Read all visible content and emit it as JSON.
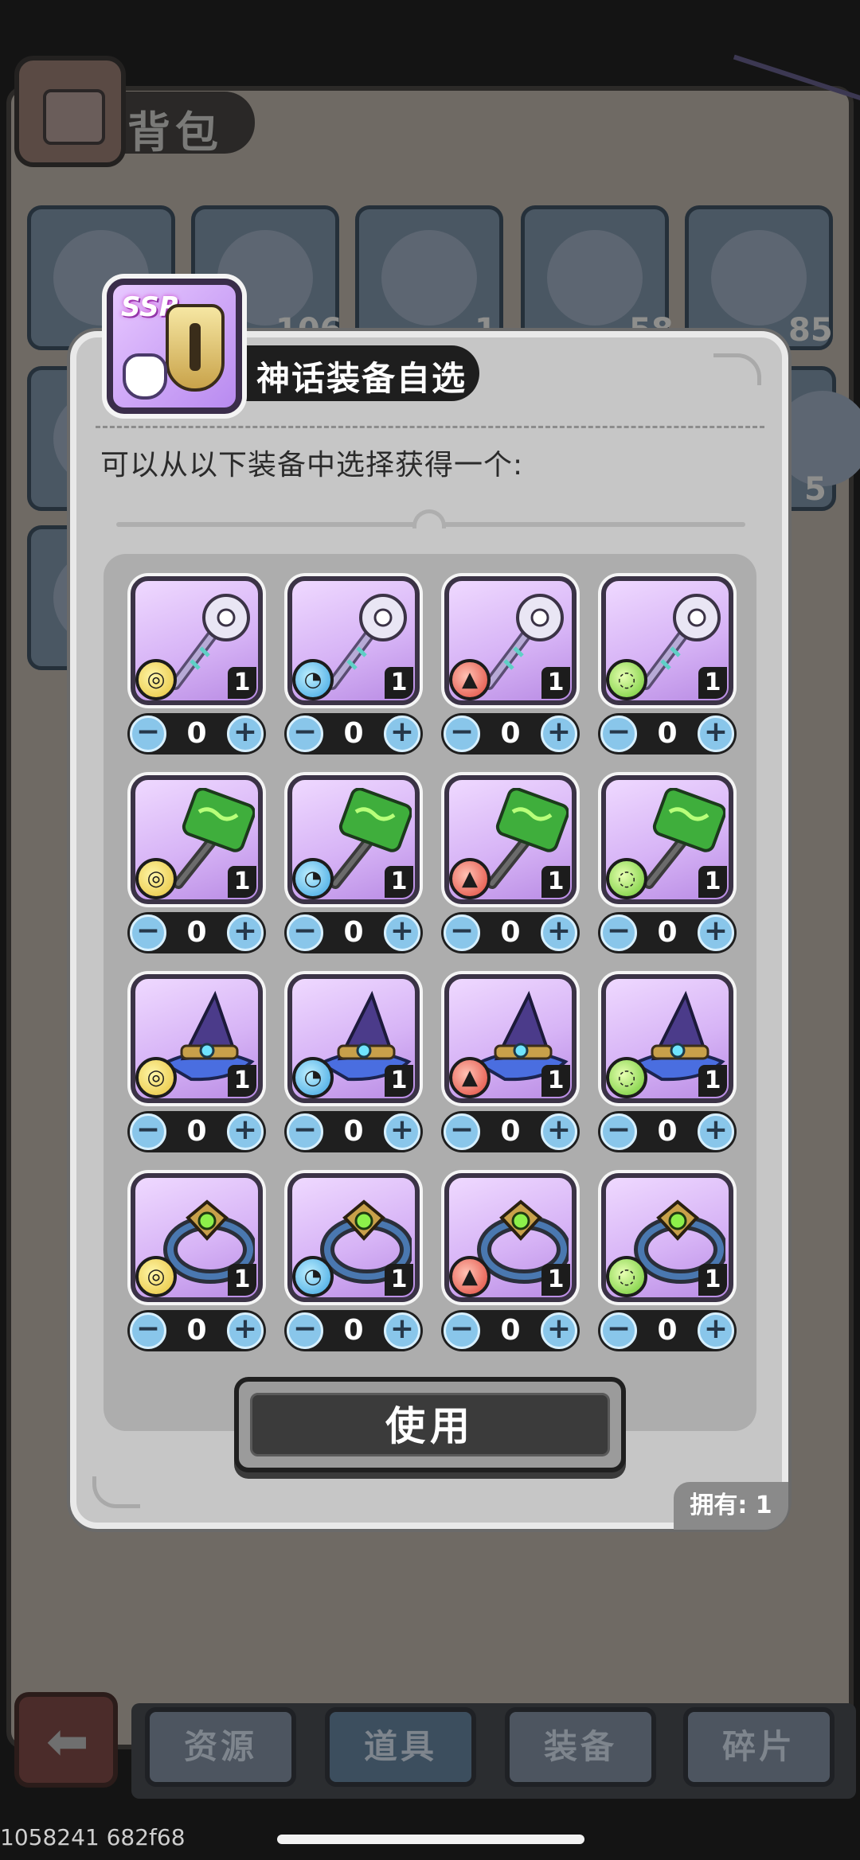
{
  "background": {
    "title": "背包",
    "slot_counts": [
      "106",
      "1",
      "58",
      "85",
      "5"
    ],
    "tabs": [
      {
        "label": "资源",
        "active": false
      },
      {
        "label": "道具",
        "active": true
      },
      {
        "label": "装备",
        "active": false
      },
      {
        "label": "碎片",
        "active": false
      }
    ],
    "debug_text": "1058241 682f68"
  },
  "modal": {
    "title": "神话装备自选",
    "badge": "SSR",
    "description": "可以从以下装备中选择获得一个:",
    "use_button_label": "使用",
    "owned_label": "拥有: 1",
    "rows": [
      {
        "item": "staff-icon",
        "cells": [
          {
            "element": "earth",
            "count": "1",
            "qty": "0"
          },
          {
            "element": "water",
            "count": "1",
            "qty": "0"
          },
          {
            "element": "fire",
            "count": "1",
            "qty": "0"
          },
          {
            "element": "wind",
            "count": "1",
            "qty": "0"
          }
        ]
      },
      {
        "item": "hammer-icon",
        "cells": [
          {
            "element": "earth",
            "count": "1",
            "qty": "0"
          },
          {
            "element": "water",
            "count": "1",
            "qty": "0"
          },
          {
            "element": "fire",
            "count": "1",
            "qty": "0"
          },
          {
            "element": "wind",
            "count": "1",
            "qty": "0"
          }
        ]
      },
      {
        "item": "wizard-hat-icon",
        "cells": [
          {
            "element": "earth",
            "count": "1",
            "qty": "0"
          },
          {
            "element": "water",
            "count": "1",
            "qty": "0"
          },
          {
            "element": "fire",
            "count": "1",
            "qty": "0"
          },
          {
            "element": "wind",
            "count": "1",
            "qty": "0"
          }
        ]
      },
      {
        "item": "ring-icon",
        "cells": [
          {
            "element": "earth",
            "count": "1",
            "qty": "0"
          },
          {
            "element": "water",
            "count": "1",
            "qty": "0"
          },
          {
            "element": "fire",
            "count": "1",
            "qty": "0"
          },
          {
            "element": "wind",
            "count": "1",
            "qty": "0"
          }
        ]
      }
    ]
  },
  "colors": {
    "earth": "#e6c23a",
    "water": "#3aa2e0",
    "fire": "#e0463a",
    "wind": "#6bc830",
    "tile_bg": "#d7b4f6"
  }
}
